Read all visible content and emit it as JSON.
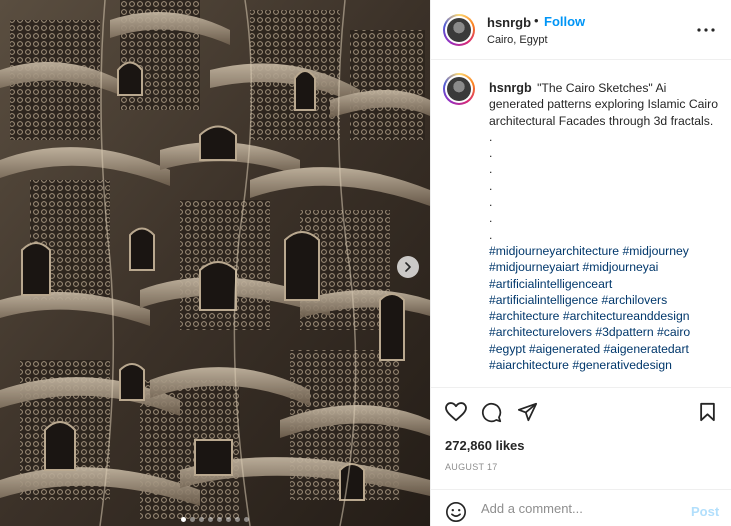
{
  "post": {
    "username": "hsnrgb",
    "separator": "•",
    "follow_label": "Follow",
    "location": "Cairo, Egypt",
    "more_label": "•••",
    "caption_username": "hsnrgb",
    "caption_text": "\"The Cairo Sketches\" Ai generated patterns exploring Islamic Cairo architectural Facades through 3d fractals.",
    "caption_dots": [
      ".",
      ".",
      ".",
      ".",
      ".",
      ".",
      "."
    ],
    "hashtags": "#midjourneyarchitecture #midjourney #midjourneyaiart #midjourneyai #artificialintelligenceart #artificialintelligence #archilovers #architecture #architectureanddesign #architecturelovers #3dpattern #cairo #egypt #aigenerated #aigeneratedart #aiarchitecture #generativedesign",
    "likes": "272,860 likes",
    "date": "AUGUST 17"
  },
  "comment_box": {
    "placeholder": "Add a comment...",
    "post_label": "Post"
  },
  "carousel": {
    "slide_count": 8,
    "active_index": 0
  },
  "icons": {
    "like": "heart-icon",
    "comment": "comment-icon",
    "share": "paper-plane-icon",
    "save": "bookmark-icon",
    "emoji": "smiley-icon",
    "next": "chevron-right-icon",
    "more": "more-dots-icon"
  },
  "colors": {
    "follow": "#0095f6",
    "hashtag": "#00376b",
    "post_disabled": "#b2dffc",
    "muted": "#8e8e8e"
  }
}
